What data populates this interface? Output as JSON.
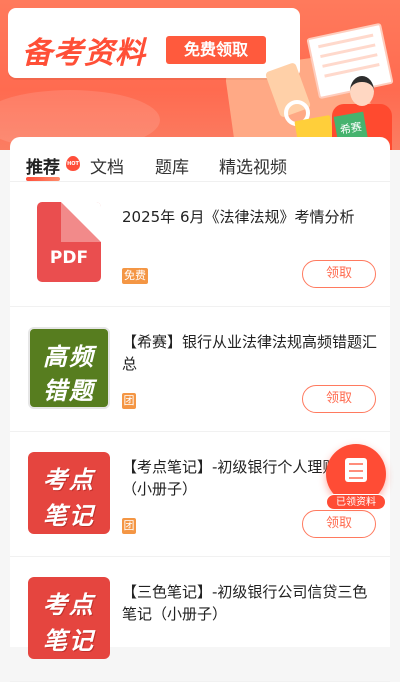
{
  "banner": {
    "title": "备考资料",
    "button_label": "免费领取",
    "person_tag": "希赛"
  },
  "tabs": [
    {
      "label": "推荐",
      "active": true
    },
    {
      "label": "文档",
      "active": false
    },
    {
      "label": "题库",
      "active": false
    },
    {
      "label": "精选视频",
      "active": false
    }
  ],
  "hot_badge": "HOT",
  "items": [
    {
      "cover_text": "PDF",
      "title": "2025年 6月《法律法规》考情分析",
      "tag": "免费",
      "action": "领取"
    },
    {
      "cover_line1": "高频",
      "cover_line2": "错题",
      "title": "【希赛】银行从业法律法规高频错题汇总",
      "tag": "团",
      "action": "领取"
    },
    {
      "cover_line1": "考点",
      "cover_line2": "笔记",
      "title": "【考点笔记】-初级银行个人理财笔记（小册子）",
      "tag": "团",
      "action": "领取"
    },
    {
      "cover_line1": "考点",
      "cover_line2": "笔记",
      "title": "【三色笔记】-初级银行公司信贷三色笔记（小册子）",
      "tag": "",
      "action": ""
    }
  ],
  "float_button": {
    "label": "已领资料",
    "icon": "document-icon"
  },
  "colors": {
    "accent": "#ff5a3d",
    "tag": "#f49644",
    "pdf": "#ea4e4f",
    "green_cover": "#577d1f"
  }
}
